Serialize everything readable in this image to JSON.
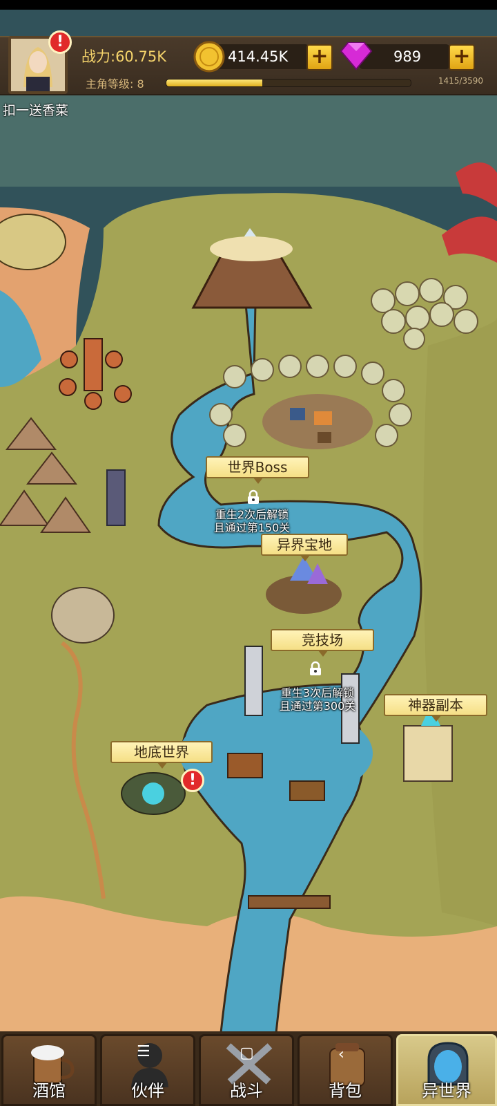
{
  "header": {
    "power": "战力:60.75K",
    "level": "主角等级: 8",
    "xp_text": "1415/3590",
    "xp_fraction": 0.394,
    "gold": "414.45K",
    "gems": "989",
    "promo": "扣一送香菜"
  },
  "map": {
    "labels": {
      "world_boss": "世界Boss",
      "world_boss_lock_line1": "重生2次后解锁",
      "world_boss_lock_line2": "且通过第150关",
      "treasure": "异界宝地",
      "arena": "竞技场",
      "arena_lock_line1": "重生3次后解锁",
      "arena_lock_line2": "且通过第300关",
      "artifact": "神器副本",
      "underground": "地底世界"
    }
  },
  "nav": {
    "tavern": "酒馆",
    "partners": "伙伴",
    "battle": "战斗",
    "bag": "背包",
    "other_world": "异世界"
  },
  "colors": {
    "grass": "#a4a455",
    "water": "#4fa6c4",
    "sand": "#e8b07a",
    "sea": "#31525a",
    "sign_bg": "#f5df86"
  }
}
